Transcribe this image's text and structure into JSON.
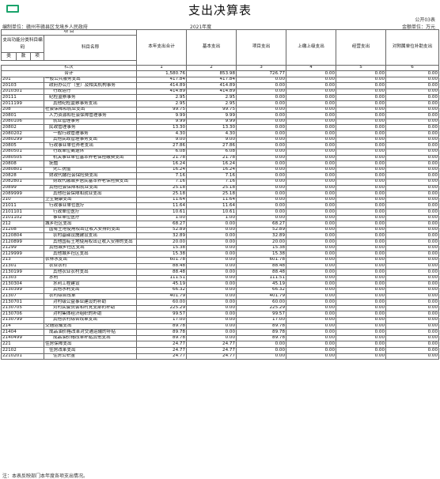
{
  "title": "支出决算表",
  "form_no": "公开03表",
  "org_label": "编制单位：赣州市赣县区戈境乡人民政府",
  "year_label": "2021年度",
  "unit_label": "金额单位：万元",
  "header": {
    "category_code": "支出功能分类科目编码",
    "item_group": "项 目",
    "subject_name": "科目名称",
    "type": "类",
    "kind": "款",
    "entry": "项",
    "row_label": "栏次",
    "col_total": "本年支出合计",
    "col_basic": "基本支出",
    "col_project": "项目支出",
    "col_upper": "上缴上级支出",
    "col_business": "经营支出",
    "col_subsidiary": "对附属单位补助支出",
    "col_nums": [
      "1",
      "2",
      "3",
      "4",
      "5",
      "6"
    ]
  },
  "total_row": {
    "name": "合计",
    "values": [
      "1,580.76",
      "853.98",
      "726.77",
      "0.00",
      "0.00",
      "0.00"
    ]
  },
  "rows": [
    {
      "code": "201",
      "name": "一般公共服务支出",
      "level": 1,
      "values": [
        "417.84",
        "417.84",
        "0.00",
        "0.00",
        "0.00",
        "0.00"
      ]
    },
    {
      "code": "20103",
      "name": "政府办公厅（室）及相关机构事务",
      "level": 2,
      "values": [
        "414.89",
        "414.89",
        "0.00",
        "0.00",
        "0.00",
        "0.00"
      ]
    },
    {
      "code": "2010301",
      "name": "行政运行",
      "level": 3,
      "values": [
        "414.89",
        "414.89",
        "0.00",
        "0.00",
        "0.00",
        "0.00"
      ]
    },
    {
      "code": "20111",
      "name": "纪检监察事务",
      "level": 2,
      "values": [
        "2.95",
        "2.95",
        "0.00",
        "0.00",
        "0.00",
        "0.00"
      ]
    },
    {
      "code": "2011199",
      "name": "其他纪检监察事务支出",
      "level": 3,
      "values": [
        "2.95",
        "2.95",
        "0.00",
        "0.00",
        "0.00",
        "0.00"
      ]
    },
    {
      "code": "208",
      "name": "社会保障和就业支出",
      "level": 1,
      "values": [
        "99.75",
        "99.75",
        "0.00",
        "0.00",
        "0.00",
        "0.00"
      ]
    },
    {
      "code": "20801",
      "name": "人力资源和社会保障管理事务",
      "level": 2,
      "values": [
        "9.99",
        "9.99",
        "0.00",
        "0.00",
        "0.00",
        "0.00"
      ]
    },
    {
      "code": "2080106",
      "name": "就业管理事务",
      "level": 3,
      "values": [
        "9.99",
        "9.99",
        "0.00",
        "0.00",
        "0.00",
        "0.00"
      ]
    },
    {
      "code": "20802",
      "name": "民政管理事务",
      "level": 2,
      "values": [
        "13.30",
        "13.30",
        "0.00",
        "0.00",
        "0.00",
        "0.00"
      ]
    },
    {
      "code": "2080202",
      "name": "一般行政管理事务",
      "level": 3,
      "values": [
        "4.30",
        "4.30",
        "0.00",
        "0.00",
        "0.00",
        "0.00"
      ]
    },
    {
      "code": "2080299",
      "name": "其他民政管理事务支出",
      "level": 3,
      "values": [
        "9.00",
        "9.00",
        "0.00",
        "0.00",
        "0.00",
        "0.00"
      ]
    },
    {
      "code": "20805",
      "name": "行政事业单位养老支出",
      "level": 2,
      "values": [
        "27.86",
        "27.86",
        "0.00",
        "0.00",
        "0.00",
        "0.00"
      ]
    },
    {
      "code": "2080501",
      "name": "行政单位离退休",
      "level": 3,
      "values": [
        "6.08",
        "6.08",
        "0.00",
        "0.00",
        "0.00",
        "0.00"
      ]
    },
    {
      "code": "2080505",
      "name": "机关事业单位基本养老保险缴费支出",
      "level": 3,
      "values": [
        "21.78",
        "21.78",
        "0.00",
        "0.00",
        "0.00",
        "0.00"
      ]
    },
    {
      "code": "20808",
      "name": "抚恤",
      "level": 2,
      "values": [
        "16.24",
        "16.24",
        "0.00",
        "0.00",
        "0.00",
        "0.00"
      ]
    },
    {
      "code": "2080801",
      "name": "死亡抚恤",
      "level": 3,
      "values": [
        "16.24",
        "16.24",
        "0.00",
        "0.00",
        "0.00",
        "0.00"
      ]
    },
    {
      "code": "20828",
      "name": "财政代缴社会保险费支出",
      "level": 2,
      "values": [
        "7.16",
        "7.16",
        "0.00",
        "0.00",
        "0.00",
        "0.00"
      ]
    },
    {
      "code": "2082801",
      "name": "财政代缴城乡居民基本养老保险费支出",
      "level": 3,
      "values": [
        "7.16",
        "7.16",
        "0.00",
        "0.00",
        "0.00",
        "0.00"
      ]
    },
    {
      "code": "20899",
      "name": "其他社会保障和就业支出",
      "level": 2,
      "values": [
        "25.18",
        "25.18",
        "0.00",
        "0.00",
        "0.00",
        "0.00"
      ]
    },
    {
      "code": "2089999",
      "name": "其他社会保障和就业支出",
      "level": 3,
      "values": [
        "25.18",
        "25.18",
        "0.00",
        "0.00",
        "0.00",
        "0.00"
      ]
    },
    {
      "code": "210",
      "name": "卫生健康支出",
      "level": 1,
      "values": [
        "11.64",
        "11.64",
        "0.00",
        "0.00",
        "0.00",
        "0.00"
      ]
    },
    {
      "code": "21011",
      "name": "行政事业单位医疗",
      "level": 2,
      "values": [
        "11.64",
        "11.64",
        "0.00",
        "0.00",
        "0.00",
        "0.00"
      ]
    },
    {
      "code": "2101101",
      "name": "行政单位医疗",
      "level": 3,
      "values": [
        "10.61",
        "10.61",
        "0.00",
        "0.00",
        "0.00",
        "0.00"
      ]
    },
    {
      "code": "2101102",
      "name": "事业单位医疗",
      "level": 3,
      "values": [
        "1.00",
        "1.00",
        "0.00",
        "0.00",
        "0.00",
        "0.00"
      ]
    },
    {
      "code": "212",
      "name": "城乡社区支出",
      "level": 1,
      "values": [
        "68.27",
        "0.00",
        "68.27",
        "0.00",
        "0.00",
        "0.00"
      ]
    },
    {
      "code": "21208",
      "name": "国有土地使用权出让收入安排的支出",
      "level": 2,
      "values": [
        "52.89",
        "0.00",
        "52.89",
        "0.00",
        "0.00",
        "0.00"
      ]
    },
    {
      "code": "2120804",
      "name": "农村基础设施建设支出",
      "level": 3,
      "values": [
        "32.89",
        "0.00",
        "32.89",
        "0.00",
        "0.00",
        "0.00"
      ]
    },
    {
      "code": "2120899",
      "name": "其他国有土地使用权出让收入安排的支出",
      "level": 3,
      "values": [
        "20.00",
        "0.00",
        "20.00",
        "0.00",
        "0.00",
        "0.00"
      ]
    },
    {
      "code": "21299",
      "name": "其他城乡社区支出",
      "level": 2,
      "values": [
        "15.38",
        "0.00",
        "15.38",
        "0.00",
        "0.00",
        "0.00"
      ]
    },
    {
      "code": "2129999",
      "name": "其他城乡社区支出",
      "level": 3,
      "values": [
        "15.38",
        "0.00",
        "15.38",
        "0.00",
        "0.00",
        "0.00"
      ]
    },
    {
      "code": "213",
      "name": "农林水支出",
      "level": 1,
      "values": [
        "601.78",
        "0.00",
        "601.78",
        "0.00",
        "0.00",
        "0.00"
      ]
    },
    {
      "code": "21301",
      "name": "农业农村",
      "level": 2,
      "values": [
        "88.48",
        "0.00",
        "88.48",
        "0.00",
        "0.00",
        "0.00"
      ]
    },
    {
      "code": "2130199",
      "name": "其他农业农村支出",
      "level": 3,
      "values": [
        "88.48",
        "0.00",
        "88.48",
        "0.00",
        "0.00",
        "0.00"
      ]
    },
    {
      "code": "21303",
      "name": "水利",
      "level": 2,
      "values": [
        "111.51",
        "0.00",
        "111.51",
        "0.00",
        "0.00",
        "0.00"
      ]
    },
    {
      "code": "2130304",
      "name": "水利工程建设",
      "level": 3,
      "values": [
        "45.19",
        "0.00",
        "45.19",
        "0.00",
        "0.00",
        "0.00"
      ]
    },
    {
      "code": "2130399",
      "name": "其他水利支出",
      "level": 3,
      "values": [
        "66.32",
        "0.00",
        "66.32",
        "0.00",
        "0.00",
        "0.00"
      ]
    },
    {
      "code": "21307",
      "name": "农村综合改革",
      "level": 2,
      "values": [
        "401.79",
        "0.00",
        "401.79",
        "0.00",
        "0.00",
        "0.00"
      ]
    },
    {
      "code": "2130701",
      "name": "对村级公益事业建设的补助",
      "level": 3,
      "values": [
        "60.00",
        "0.00",
        "60.00",
        "0.00",
        "0.00",
        "0.00"
      ]
    },
    {
      "code": "2130705",
      "name": "对村民委员会和村党支部的补助",
      "level": 3,
      "values": [
        "225.29",
        "0.00",
        "225.29",
        "0.00",
        "0.00",
        "0.00"
      ]
    },
    {
      "code": "2130706",
      "name": "对村集体经济组织的补助",
      "level": 3,
      "values": [
        "99.57",
        "0.00",
        "99.57",
        "0.00",
        "0.00",
        "0.00"
      ]
    },
    {
      "code": "2130799",
      "name": "其他农村综合改革支出",
      "level": 3,
      "values": [
        "17.00",
        "0.00",
        "17.00",
        "0.00",
        "0.00",
        "0.00"
      ]
    },
    {
      "code": "214",
      "name": "交通运输支出",
      "level": 1,
      "values": [
        "89.78",
        "0.00",
        "89.78",
        "0.00",
        "0.00",
        "0.00"
      ]
    },
    {
      "code": "21404",
      "name": "成品油价格改革对交通运输的补贴",
      "level": 2,
      "values": [
        "89.78",
        "0.00",
        "89.78",
        "0.00",
        "0.00",
        "0.00"
      ]
    },
    {
      "code": "2140499",
      "name": "成品油价格改革补贴其他支出",
      "level": 3,
      "values": [
        "89.78",
        "0.00",
        "89.78",
        "0.00",
        "0.00",
        "0.00"
      ]
    },
    {
      "code": "221",
      "name": "住房保障支出",
      "level": 1,
      "values": [
        "24.77",
        "24.77",
        "0.00",
        "0.00",
        "0.00",
        "0.00"
      ]
    },
    {
      "code": "22102",
      "name": "住房改革支出",
      "level": 2,
      "values": [
        "24.77",
        "24.77",
        "0.00",
        "0.00",
        "0.00",
        "0.00"
      ]
    },
    {
      "code": "2210201",
      "name": "住房公积金",
      "level": 3,
      "values": [
        "24.77",
        "24.77",
        "0.00",
        "0.00",
        "0.00",
        "0.00"
      ]
    }
  ],
  "footnote": "注：本表反映部门本年度各项支出情况。"
}
